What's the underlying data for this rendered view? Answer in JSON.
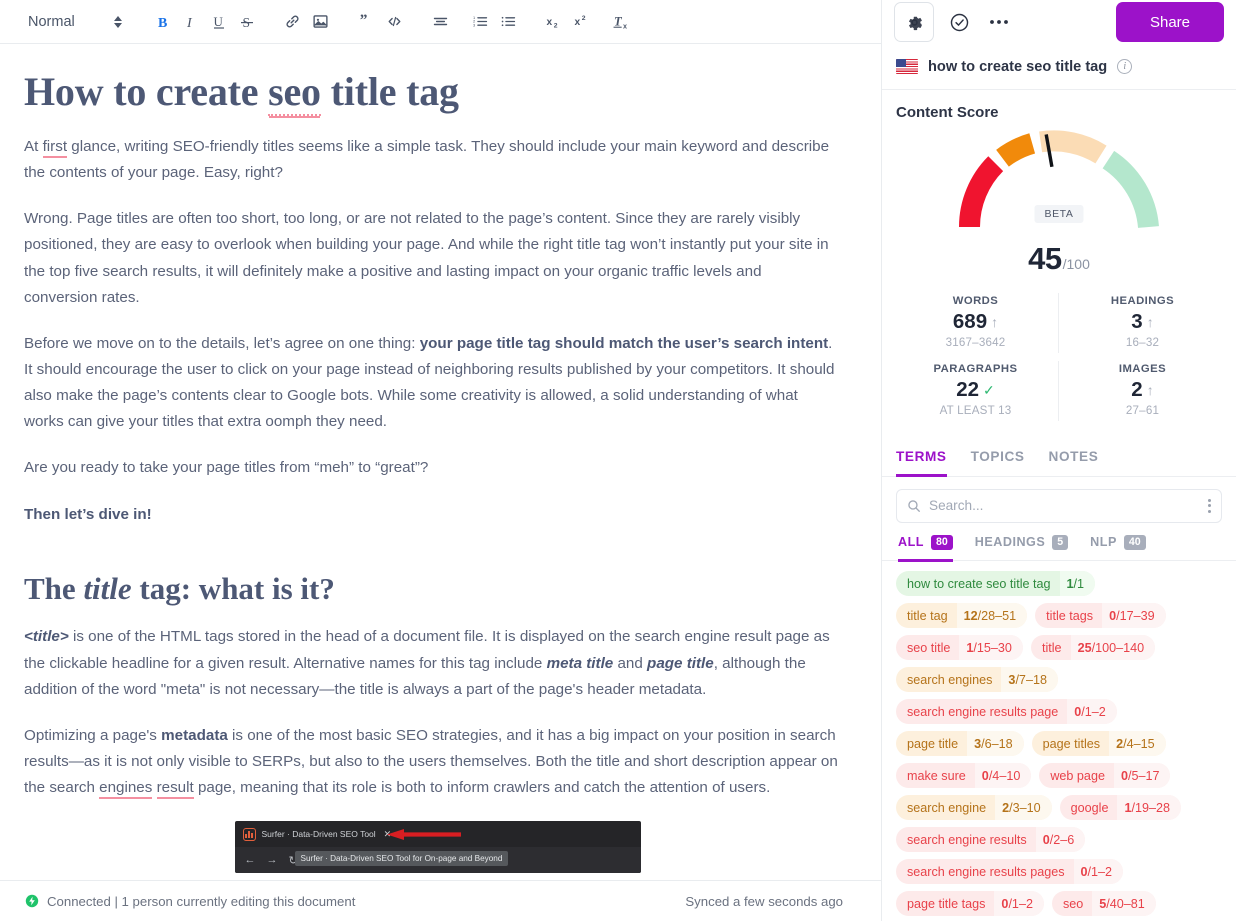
{
  "toolbar": {
    "style_label": "Normal",
    "buttons": [
      {
        "name": "bold-button",
        "glyph": "B",
        "active": true
      },
      {
        "name": "italic-button",
        "glyph": "I",
        "active": false
      },
      {
        "name": "underline-button",
        "glyph": "U",
        "active": false
      },
      {
        "name": "strikethrough-button",
        "glyph": "S",
        "active": false
      },
      {
        "name": "link-button",
        "glyph": "link",
        "active": false
      },
      {
        "name": "image-button",
        "glyph": "image",
        "active": false
      },
      {
        "name": "blockquote-button",
        "glyph": "quote",
        "active": false
      },
      {
        "name": "code-button",
        "glyph": "code",
        "active": false
      },
      {
        "name": "align-button",
        "glyph": "align",
        "active": false
      },
      {
        "name": "ordered-list-button",
        "glyph": "ol",
        "active": false
      },
      {
        "name": "unordered-list-button",
        "glyph": "ul",
        "active": false
      },
      {
        "name": "subscript-button",
        "glyph": "x2sub",
        "active": false
      },
      {
        "name": "superscript-button",
        "glyph": "x2sup",
        "active": false
      },
      {
        "name": "clear-formatting-button",
        "glyph": "Tx",
        "active": false
      }
    ]
  },
  "document": {
    "title_prefix": "How to create ",
    "title_misspelled": "seo",
    "title_suffix": " title tag",
    "p1_a": "At ",
    "p1_mis": "first",
    "p1_b": " glance, writing SEO-friendly titles seems like a simple task. They should include your main keyword and describe the contents of your page. Easy, right?",
    "p2": "Wrong. Page titles are often too short, too long, or are not related to the page’s content. Since they are rarely visibly positioned, they are easy to overlook when building your page. And while the right title tag won’t instantly put your site in the top five search results, it will definitely make a positive and lasting impact on your organic traffic levels and conversion rates.",
    "p3_a": "Before we move on to the details, let’s agree on one thing: ",
    "p3_bold": "your page title tag should match the user’s search intent",
    "p3_b": ". It should encourage the user to click on your page instead of neighboring results published by your competitors. It should also make the page’s contents clear to Google bots. While some creativity is allowed, a solid understanding of what works can give your titles that extra oomph they need.",
    "p4": "Are you ready to take your page titles from “meh” to “great”?",
    "p5_bold": "Then let’s dive in!",
    "h2_a": "The ",
    "h2_em": "title",
    "h2_b": " tag: what is it?",
    "p6_code": "<title>",
    "p6_a": " is one of the HTML tags stored in the head of a document file. It is displayed on the search engine result page as the clickable headline for a given result. Alternative names for this tag include ",
    "p6_em1": "meta title",
    "p6_mid": " and ",
    "p6_em2": "page title",
    "p6_b": ", although the addition of the word \"meta\" is not necessary—the title is always a part of the page's header metadata.",
    "p7_a": "Optimizing a page's ",
    "p7_bold": "metadata",
    "p7_b": " is one of the most basic SEO strategies, and it has a big impact on your position in search results—as it is not only visible to SERPs, but also to the users themselves. Both the title and short description appear on the search ",
    "p7_mis1": "engines",
    "p7_mid": " ",
    "p7_mis2": "result",
    "p7_c": " page, meaning that its role is both to inform crawlers and catch the attention of users."
  },
  "embed": {
    "tab_title": "Surfer · Data-Driven SEO Tool",
    "close_glyph": "✕",
    "tooltip": "Surfer · Data-Driven SEO Tool for On-page and Beyond",
    "back_glyph": "←",
    "forward_glyph": "→",
    "reload_glyph": "↻"
  },
  "statusbar": {
    "connection": "Connected | 1 person currently editing this document",
    "sync": "Synced a few seconds ago",
    "dot_color": "#1fc36a"
  },
  "sidebar": {
    "share_label": "Share",
    "keyword": "how to create seo title tag",
    "content_score_label": "Content Score",
    "gauge": {
      "beta_label": "BETA",
      "score": "45",
      "denominator": "/100",
      "value": 45,
      "max": 100,
      "segments": [
        {
          "from": 0,
          "to": 33,
          "color": "#f0142f"
        },
        {
          "from": 35,
          "to": 43,
          "color": "#f18a0b"
        },
        {
          "from": 45,
          "to": 65,
          "color": "#fbdcb5"
        },
        {
          "from": 67,
          "to": 100,
          "color": "#b4e7cd"
        }
      ],
      "needle_color": "#101318"
    },
    "stats": [
      {
        "label": "WORDS",
        "value": "689",
        "status": "up",
        "range": "3167–3642"
      },
      {
        "label": "HEADINGS",
        "value": "3",
        "status": "up",
        "range": "16–32"
      },
      {
        "label": "PARAGRAPHS",
        "value": "22",
        "status": "ok",
        "range": "AT LEAST 13"
      },
      {
        "label": "IMAGES",
        "value": "2",
        "status": "up",
        "range": "27–61"
      }
    ],
    "tabs": [
      {
        "label": "TERMS",
        "selected": true
      },
      {
        "label": "TOPICS",
        "selected": false
      },
      {
        "label": "NOTES",
        "selected": false
      }
    ],
    "search_placeholder": "Search...",
    "search_value": "",
    "filters": [
      {
        "label": "ALL",
        "count": "80",
        "selected": true
      },
      {
        "label": "HEADINGS",
        "count": "5",
        "selected": false
      },
      {
        "label": "NLP",
        "count": "40",
        "selected": false
      }
    ],
    "terms": [
      {
        "term": "how to create seo title tag",
        "used": "1",
        "target": "/1",
        "state": "green"
      },
      {
        "term": "title tag",
        "used": "12",
        "target": "/28–51",
        "state": "amber"
      },
      {
        "term": "title tags",
        "used": "0",
        "target": "/17–39",
        "state": "red"
      },
      {
        "term": "seo title",
        "used": "1",
        "target": "/15–30",
        "state": "red"
      },
      {
        "term": "title",
        "used": "25",
        "target": "/100–140",
        "state": "red"
      },
      {
        "term": "search engines",
        "used": "3",
        "target": "/7–18",
        "state": "amber"
      },
      {
        "term": "search engine results page",
        "used": "0",
        "target": "/1–2",
        "state": "red"
      },
      {
        "term": "page title",
        "used": "3",
        "target": "/6–18",
        "state": "amber"
      },
      {
        "term": "page titles",
        "used": "2",
        "target": "/4–15",
        "state": "amber"
      },
      {
        "term": "make sure",
        "used": "0",
        "target": "/4–10",
        "state": "red"
      },
      {
        "term": "web page",
        "used": "0",
        "target": "/5–17",
        "state": "red"
      },
      {
        "term": "search engine",
        "used": "2",
        "target": "/3–10",
        "state": "amber"
      },
      {
        "term": "google",
        "used": "1",
        "target": "/19–28",
        "state": "red"
      },
      {
        "term": "search engine results",
        "used": "0",
        "target": "/2–6",
        "state": "red"
      },
      {
        "term": "search engine results pages",
        "used": "0",
        "target": "/1–2",
        "state": "red"
      },
      {
        "term": "page title tags",
        "used": "0",
        "target": "/1–2",
        "state": "red"
      },
      {
        "term": "seo",
        "used": "5",
        "target": "/40–81",
        "state": "red"
      }
    ]
  }
}
